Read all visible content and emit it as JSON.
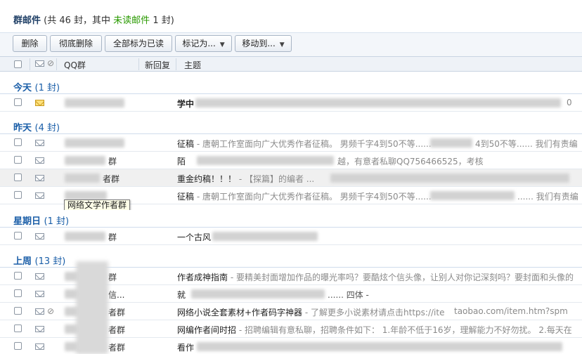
{
  "header": {
    "folder_name": "群邮件",
    "count_prefix": "(共 46 封，其中 ",
    "unread_label": "未读邮件",
    "count_suffix": " 1 封)"
  },
  "toolbar": {
    "delete": "删除",
    "delete_permanently": "彻底删除",
    "mark_all_read": "全部标为已读",
    "mark_as": "标记为...",
    "move_to": "移动到..."
  },
  "columns": {
    "group": "QQ群",
    "new_reply": "新回复",
    "subject": "主题"
  },
  "groups": {
    "today": {
      "label": "今天",
      "count": "(1 封)"
    },
    "yesterday": {
      "label": "昨天",
      "count": "(4 封)"
    },
    "sunday": {
      "label": "星期日",
      "count": "(1 封)"
    },
    "last_week": {
      "label": "上周",
      "count": "(13 封)"
    }
  },
  "rows": [
    {
      "sender": "",
      "subject": "学中",
      "summary": "",
      "tail": "0"
    },
    {
      "sender": "",
      "subject": "征稿",
      "summary": " - 唐朝工作室面向广大优秀作者征稿。 男频千字4到50不等......",
      "tail": "4到50不等...... 我们有责编"
    },
    {
      "sender": "群",
      "subject": "陌",
      "summary": "",
      "tail": "越，有意者私聊QQ756466525，考核"
    },
    {
      "sender": "者群",
      "subject": "重金约稿！！！",
      "summary": " - 【探篇】的编者 ...",
      "tail": ""
    },
    {
      "sender": "",
      "subject": "征稿",
      "summary": " - 唐朝工作室面向广大优秀作者征稿。 男频千字4到50不等......",
      "tail": "...... 我们有责编"
    },
    {
      "sender": "群",
      "subject": "一个古风",
      "summary": "",
      "tail": ""
    },
    {
      "sender": "群",
      "subject": "作者成神指南",
      "summary": " - 要精美封面增加作品的曝光率吗？要酷炫个信头像，让别人对你记深刻吗？要封面和头像的",
      "tail": ""
    },
    {
      "sender": "信...",
      "subject": "就",
      "summary": "",
      "tail": "...... 四体 -"
    },
    {
      "sender": "者群",
      "subject": "网络小说全套素材+作者码字神器",
      "summary": " - 了解更多小说素材请点击https://ite",
      "tail": "taobao.com/item.htm?spm"
    },
    {
      "sender": "者群",
      "subject": "网编作者间时招",
      "summary": " - 招聘编辑有意私聊，招聘条件如下： 1.年龄不低于16岁，理解能力不好勿扰。 2.每天在",
      "tail": ""
    },
    {
      "sender": "者群",
      "subject": "看作",
      "summary": "",
      "tail": ""
    }
  ],
  "tooltip": "网络文学作者群"
}
